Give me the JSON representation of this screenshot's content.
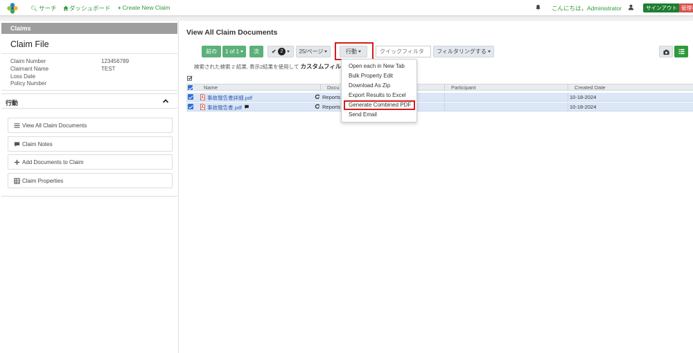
{
  "topnav": {
    "search_label": "サーチ",
    "dashboard_label": "ダッシュボード",
    "create_claim_label": "Create New Claim",
    "greeting": "こんにちは，Administrator",
    "signout_label": "サインアウト",
    "admin_label": "管理者"
  },
  "sidebar": {
    "claims_header": "Claims",
    "claim_file_title": "Claim File",
    "claim_number_label": "Claim Number",
    "claim_number_value": "123456789",
    "claimant_name_label": "Claimant Name",
    "claimant_name_value": "TEST",
    "loss_date_label": "Loss Date",
    "policy_number_label": "Policy Number",
    "actions_title": "行動",
    "actions": [
      {
        "label": "View All Claim Documents",
        "icon": "list-icon"
      },
      {
        "label": "Claim Notes",
        "icon": "comment-icon"
      },
      {
        "label": "Add Documents to Claim",
        "icon": "plus-icon"
      },
      {
        "label": "Claim Properties",
        "icon": "table-icon"
      }
    ]
  },
  "main": {
    "page_title": "View All Claim Documents",
    "toolbar": {
      "prev_label": "前の",
      "page_label": "1 of 1",
      "next_label": "次",
      "selected_count": "2",
      "per_page_label": "25/ページ",
      "actions_label": "行動",
      "quick_filter_placeholder": "クイックフィルタ",
      "filter_label": "フィルタリングする"
    },
    "info_text": "検索された検索 2 結果, 表示2結果を使用して",
    "info_bold": "カスタムフィルタ",
    "columns": {
      "name": "Name",
      "doc_type": "Docu",
      "participant": "Participant",
      "created_date": "Created Date"
    },
    "rows": [
      {
        "name": "事故報告書詳細.pdf",
        "doc_type": "Reports",
        "created": "10-18-2024"
      },
      {
        "name": "事故報告書.pdf",
        "doc_type": "Reports",
        "created": "10-18-2024"
      }
    ],
    "dropdown": [
      "Open each in New Tab",
      "Bulk Property Edit",
      "Download As Zip",
      "Export Results to Excel",
      "Generate Combined PDF",
      "Send Email"
    ]
  },
  "colors": {
    "accent_green": "#2e9a3c",
    "button_green": "#5cb079",
    "highlight_red": "#d41c1c",
    "row_blue": "#dbe7f7"
  }
}
